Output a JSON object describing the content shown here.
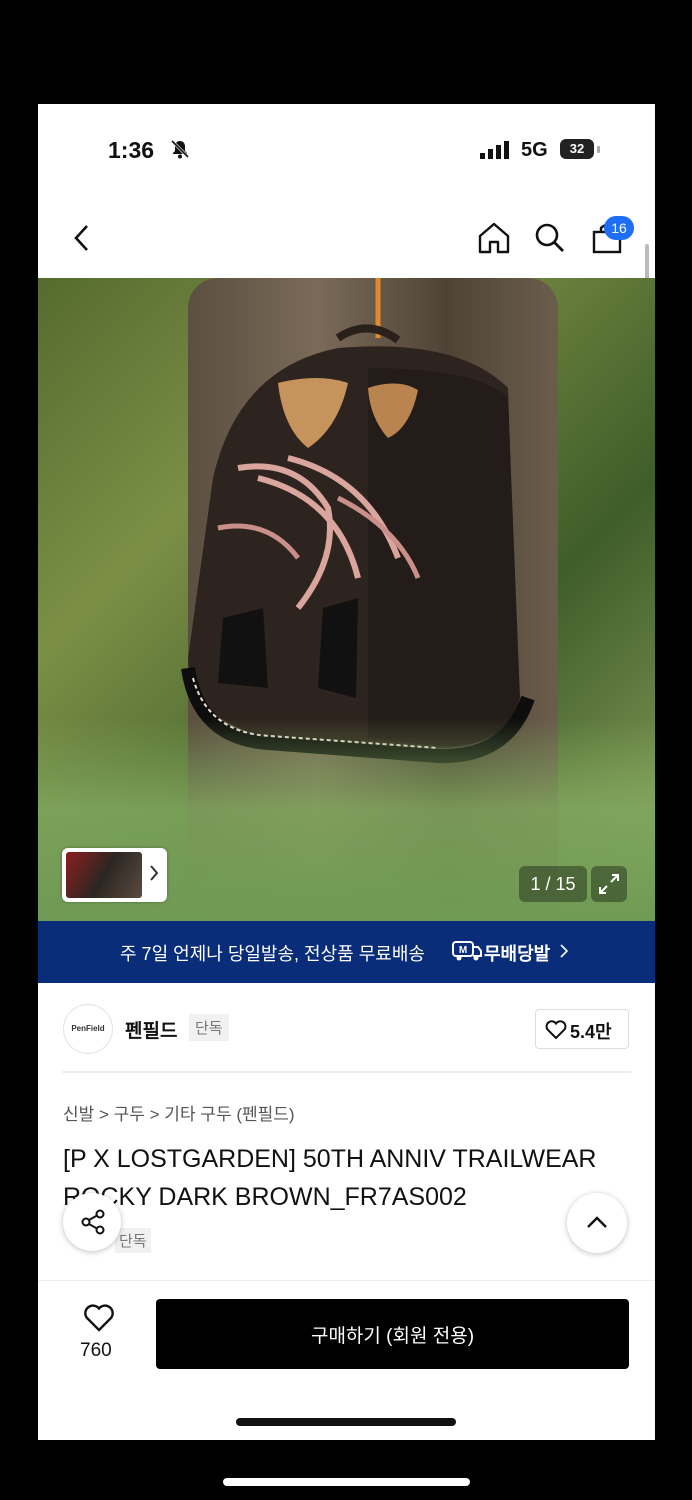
{
  "status_bar": {
    "time": "1:36",
    "network": "5G",
    "battery": "32"
  },
  "nav": {
    "cart_count": "16"
  },
  "gallery": {
    "counter": "1 / 15"
  },
  "promo": {
    "text": "주 7일 언제나 당일발송, 전상품 무료배송",
    "logo": "M",
    "brand": "무배당발"
  },
  "brand": {
    "logo_text": "PenField",
    "name": "펜필드",
    "badge": "단독",
    "likes": "5.4만"
  },
  "product": {
    "breadcrumb": "신발 > 구두 > 기타 구두 (펜필드)",
    "title": "[P X LOSTGARDEN] 50TH ANNIV TRAILWEAR ROCKY DARK BROWN_FR7AS002",
    "badge": "단독"
  },
  "bottom": {
    "wish_count": "760",
    "buy_label": "구매하기 (회원 전용)"
  }
}
